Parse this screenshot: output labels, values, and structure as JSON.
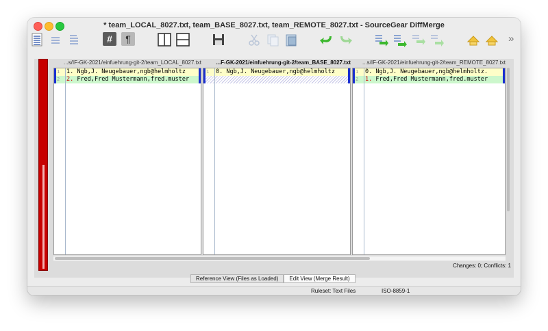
{
  "window": {
    "title": "* team_LOCAL_8027.txt, team_BASE_8027.txt, team_REMOTE_8027.txt - SourceGear DiffMerge"
  },
  "toolbar": {
    "more": "»",
    "hash_label": "#",
    "pilcrow_label": "¶"
  },
  "panes": [
    {
      "header": "...s/IF-GK-2021/einfuehrung-git-2/team_LOCAL_8027.txt",
      "lines": [
        {
          "number": "1",
          "marker": "1.",
          "text": "  Ngb,J. Neugebauer,ngb@helmholtz"
        },
        {
          "number": "2",
          "marker": "2.",
          "text": "  Fred,Fred Mustermann,fred.muster"
        }
      ]
    },
    {
      "header": "...F-GK-2021/einfuehrung-git-2/team_BASE_8027.txt",
      "lines": [
        {
          "number": "1",
          "marker": "0.",
          "text": "  Ngb,J. Neugebauer,ngb@helmholtz"
        }
      ]
    },
    {
      "header": "...s/IF-GK-2021/einfuehrung-git-2/team_REMOTE_8027.txt",
      "lines": [
        {
          "number": "1",
          "marker": "0.",
          "text": "  Ngb,J. Neugebauer,ngb@helmholtz."
        },
        {
          "number": "2",
          "marker": "1.",
          "text": "  Fred,Fred Mustermann,fred.muster"
        }
      ]
    }
  ],
  "changes_summary": "Changes: 0; Conflicts: 1",
  "view_tabs": [
    "Reference View (Files as Loaded)",
    "Edit View (Merge Result)"
  ],
  "status": {
    "ruleset": "Ruleset: Text Files",
    "encoding": "ISO-8859-1"
  },
  "colors": {
    "overview_bar": "#c70000",
    "change_marker": "#1a2fd0",
    "added_line": "#ccf7cc",
    "changed_line": "#fefec8",
    "undo_arrow": "#3cb82e"
  }
}
